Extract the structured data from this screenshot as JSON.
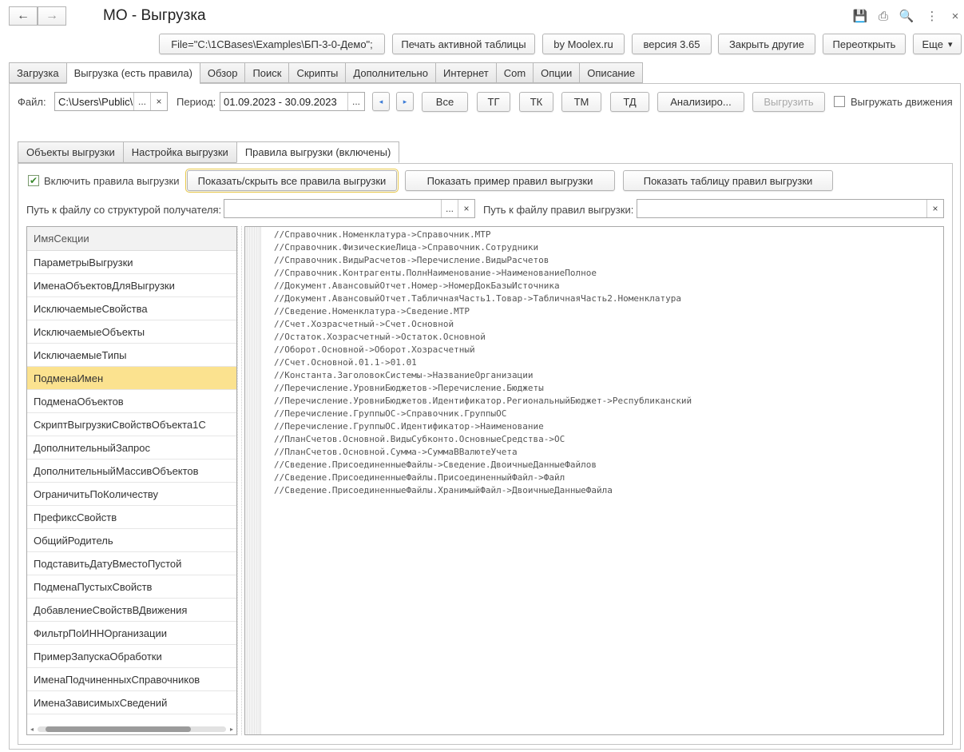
{
  "window": {
    "title": "МО - Выгрузка",
    "nav_back": "←",
    "nav_forward": "→"
  },
  "window_icons": [
    {
      "name": "save-icon",
      "glyph": "💾"
    },
    {
      "name": "print-icon",
      "glyph": "⎙"
    },
    {
      "name": "preview-icon",
      "glyph": "🔍"
    },
    {
      "name": "more-vertical-icon",
      "glyph": "⋮"
    },
    {
      "name": "close-icon",
      "glyph": "×"
    }
  ],
  "toolbar": {
    "file_button": "File=\"C:\\1CBases\\Examples\\БП-3-0-Демо\";",
    "print_table": "Печать активной таблицы",
    "by_moolex": "by Moolex.ru",
    "version": "версия 3.65",
    "close_others": "Закрыть другие",
    "reopen": "Переоткрыть",
    "more": "Еще",
    "more_arrow": "▾"
  },
  "main_tabs": [
    {
      "label": "Загрузка",
      "active": false
    },
    {
      "label": "Выгрузка (есть правила)",
      "active": true
    },
    {
      "label": "Обзор",
      "active": false
    },
    {
      "label": "Поиск",
      "active": false
    },
    {
      "label": "Скрипты",
      "active": false
    },
    {
      "label": "Дополнительно",
      "active": false
    },
    {
      "label": "Интернет",
      "active": false
    },
    {
      "label": "Com",
      "active": false
    },
    {
      "label": "Опции",
      "active": false
    },
    {
      "label": "Описание",
      "active": false
    }
  ],
  "filters": {
    "file_label": "Файл:",
    "file_value": "C:\\Users\\Public\\",
    "file_choose": "...",
    "file_clear": "×",
    "period_label": "Период:",
    "period_value": "01.09.2023 - 30.09.2023",
    "period_choose": "...",
    "period_prev": "◂",
    "period_next": "▸",
    "all": "Все",
    "tg": "ТГ",
    "tk": "ТК",
    "tm": "ТМ",
    "td": "ТД",
    "analyze": "Анализиро...",
    "export": "Выгрузить",
    "export_movements": "Выгружать движения"
  },
  "sub_tabs": [
    {
      "label": "Объекты выгрузки",
      "active": false
    },
    {
      "label": "Настройка выгрузки",
      "active": false
    },
    {
      "label": "Правила выгрузки (включены)",
      "active": true
    }
  ],
  "rules": {
    "enable_label": "Включить правила выгрузки",
    "enable_checked": "✔",
    "toggle_all": "Показать/скрыть все правила выгрузки",
    "show_example": "Показать пример правил выгрузки",
    "show_table": "Показать таблицу правил выгрузки",
    "struct_path_label": "Путь к файлу со структурой получателя:",
    "struct_path_value": "",
    "struct_choose": "...",
    "struct_clear": "×",
    "rules_path_label": "Путь к файлу правил выгрузки:",
    "rules_path_value": "",
    "rules_clear": "×"
  },
  "section_list": {
    "header": "ИмяСекции",
    "rows": [
      "ПараметрыВыгрузки",
      "ИменаОбъектовДляВыгрузки",
      "ИсключаемыеСвойства",
      "ИсключаемыеОбъекты",
      "ИсключаемыеТипы",
      "ПодменаИмен",
      "ПодменаОбъектов",
      "СкриптВыгрузкиСвойствОбъекта1С",
      "ДополнительныйЗапрос",
      "ДополнительныйМассивОбъектов",
      "ОграничитьПоКоличеству",
      "ПрефиксСвойств",
      "ОбщийРодитель",
      "ПодставитьДатуВместоПустой",
      "ПодменаПустыхСвойств",
      "ДобавлениеСвойствВДвижения",
      "ФильтрПоИННОрганизации",
      "ПримерЗапускаОбработки",
      "ИменаПодчиненныхСправочников",
      "ИменаЗависимыхСведений"
    ],
    "selected": "ПодменаИмен",
    "scroll_left": "◂",
    "scroll_right": "▸"
  },
  "code_lines": [
    "//Справочник.Номенклатура->Справочник.МТР",
    "//Справочник.ФизическиеЛица->Справочник.Сотрудники",
    "//Справочник.ВидыРасчетов->Перечисление.ВидыРасчетов",
    "//Справочник.Контрагенты.ПолнНаименование->НаименованиеПолное",
    "//Документ.АвансовыйОтчет.Номер->НомерДокБазыИсточника",
    "//Документ.АвансовыйОтчет.ТабличнаяЧасть1.Товар->ТабличнаяЧасть2.Номенклатура",
    "//Сведение.Номенклатура->Сведение.МТР",
    "//Счет.Хозрасчетный->Счет.Основной",
    "//Остаток.Хозрасчетный->Остаток.Основной",
    "//Оборот.Основной->Оборот.Хозрасчетный",
    "//Счет.Основной.01.1->01.01",
    "//Константа.ЗаголовокСистемы->НазваниеОрганизации",
    "//Перечисление.УровниБюджетов->Перечисление.Бюджеты",
    "//Перечисление.УровниБюджетов.Идентификатор.РегиональныйБюджет->Республиканский",
    "//Перечисление.ГруппыОС->Справочник.ГруппыОС",
    "//Перечисление.ГруппыОС.Идентификатор->Наименование",
    "//ПланСчетов.Основной.ВидыСубконто.ОсновныеСредства->ОС",
    "//ПланСчетов.Основной.Сумма->СуммаВВалютеУчета",
    "//Сведение.ПрисоединенныеФайлы->Сведение.ДвоичныеДанныеФайлов",
    "//Сведение.ПрисоединенныеФайлы.ПрисоединенныйФайл->Файл",
    "//Сведение.ПрисоединенныеФайлы.ХранимыйФайл->ДвоичныеДанныеФайла"
  ]
}
